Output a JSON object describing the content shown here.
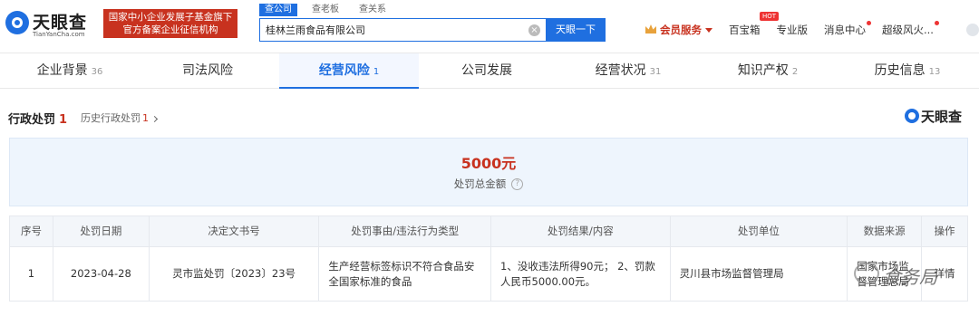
{
  "header": {
    "logo_name": "天眼查",
    "logo_domain": "TianYanCha.com",
    "gov_badge_line1": "国家中小企业发展子基金旗下",
    "gov_badge_line2": "官方备案企业征信机构",
    "search_tabs": [
      {
        "label": "查公司",
        "active": true
      },
      {
        "label": "查老板",
        "active": false
      },
      {
        "label": "查关系",
        "active": false
      }
    ],
    "search_value": "桂林兰雨食品有限公司",
    "clear_symbol": "×",
    "search_button": "天眼一下",
    "vip_label": "会员服务",
    "links": {
      "baibaoxiang": "百宝箱",
      "hot": "HOT",
      "pro": "专业版",
      "messages": "消息中心",
      "user": "超级风火..."
    }
  },
  "nav": [
    {
      "label": "企业背景",
      "count": "36",
      "active": false
    },
    {
      "label": "司法风险",
      "count": "",
      "active": false
    },
    {
      "label": "经营风险",
      "count": "1",
      "active": true
    },
    {
      "label": "公司发展",
      "count": "",
      "active": false
    },
    {
      "label": "经营状况",
      "count": "31",
      "active": false
    },
    {
      "label": "知识产权",
      "count": "2",
      "active": false
    },
    {
      "label": "历史信息",
      "count": "13",
      "active": false
    }
  ],
  "section": {
    "title": "行政处罚",
    "count": "1",
    "history_label": "历史行政处罚",
    "history_count": "1",
    "watermark": "天眼查"
  },
  "summary": {
    "amount": "5000元",
    "label": "处罚总金额",
    "help": "?"
  },
  "table": {
    "headers": [
      "序号",
      "处罚日期",
      "决定文书号",
      "处罚事由/违法行为类型",
      "处罚结果/内容",
      "处罚单位",
      "数据来源",
      "操作"
    ],
    "rows": [
      {
        "index": "1",
        "date": "2023-04-28",
        "doc_no": "灵市监处罚〔2023〕23号",
        "reason": "生产经营标签标识不符合食品安全国家标准的食品",
        "result": "1、没收违法所得90元； 2、罚款人民币5000.00元。",
        "unit": "灵川县市场监督管理局",
        "source": "国家市场监督管理总局",
        "action": "详情"
      }
    ]
  },
  "overlay": {
    "text": "食务局"
  }
}
